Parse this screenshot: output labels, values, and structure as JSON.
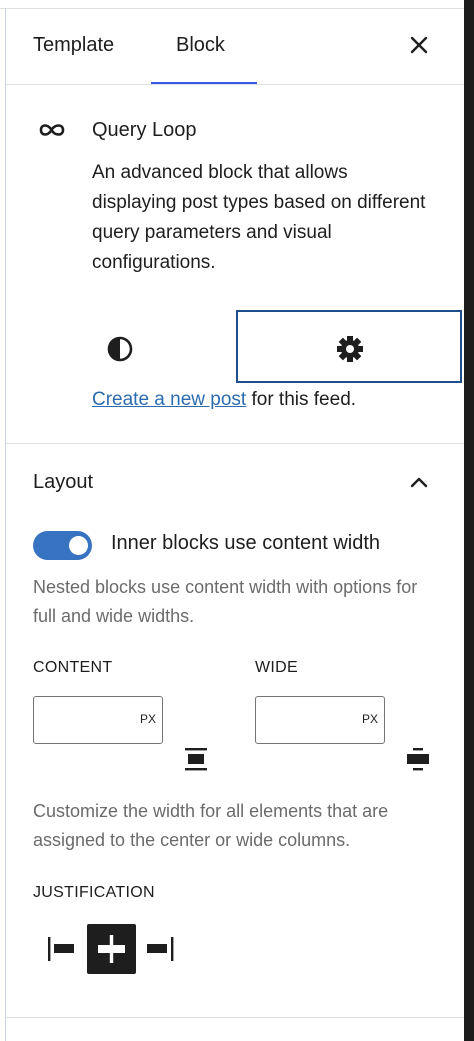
{
  "tabs": [
    {
      "label": "Template"
    },
    {
      "label": "Block"
    }
  ],
  "block": {
    "title": "Query Loop",
    "description": "An advanced block that allows displaying post types based on different query parameters and visual configurations.",
    "create_link": "Create a new post",
    "create_suffix": " for this feed."
  },
  "layout": {
    "title": "Layout",
    "toggle_label": "Inner blocks use content width",
    "toggle_on": true,
    "toggle_help": "Nested blocks use content width with options for full and wide widths.",
    "content_label": "CONTENT",
    "content_unit": "PX",
    "wide_label": "WIDE",
    "wide_unit": "PX",
    "width_help": "Customize the width for all elements that are assigned to the center or wide columns.",
    "justification_label": "JUSTIFICATION",
    "justification_selected": "center"
  },
  "colors": {
    "accent": "#3858e9",
    "toggle": "#3873c2",
    "link": "#2b6cb0"
  },
  "icons": {
    "close": "close-icon",
    "block": "query-loop-icon",
    "styles": "styles-icon",
    "settings": "gear-icon",
    "collapse": "chevron-up-icon"
  }
}
